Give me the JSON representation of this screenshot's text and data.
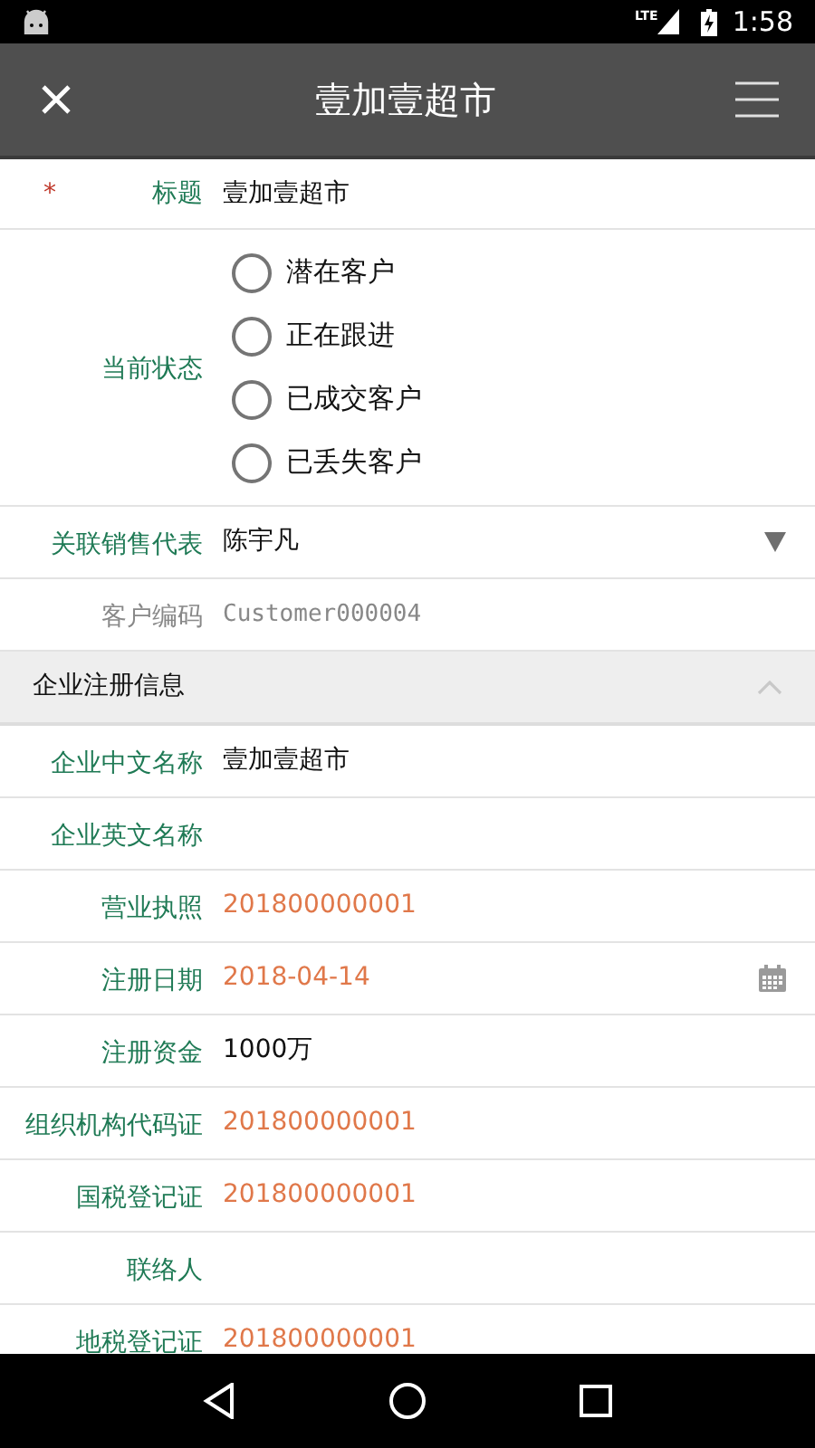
{
  "status_bar": {
    "network": "LTE",
    "time": "1:58"
  },
  "app_bar": {
    "title": "壹加壹超市"
  },
  "title_field": {
    "required_mark": "*",
    "label": "标题",
    "value": "壹加壹超市"
  },
  "status_field": {
    "label": "当前状态",
    "options": [
      {
        "label": "潜在客户",
        "selected": false
      },
      {
        "label": "正在跟进",
        "selected": false
      },
      {
        "label": "已成交客户",
        "selected": false
      },
      {
        "label": "已丢失客户",
        "selected": false
      }
    ]
  },
  "fields": [
    {
      "kind": "select",
      "label": "关联销售代表",
      "value": "陈宇凡",
      "disabled": false
    },
    {
      "kind": "text",
      "label": "客户编码",
      "value": "Customer000004",
      "disabled": true
    }
  ],
  "section": {
    "title": "企业注册信息",
    "expanded": true
  },
  "section_fields": [
    {
      "kind": "text",
      "label": "企业中文名称",
      "value": "壹加壹超市",
      "highlighted": false
    },
    {
      "kind": "text",
      "label": "企业英文名称"
    },
    {
      "kind": "text",
      "label": "营业执照",
      "value": "201800000001",
      "highlighted": true
    },
    {
      "kind": "date",
      "label": "注册日期",
      "value": "2018-04-14",
      "highlighted": true
    },
    {
      "kind": "text",
      "label": "注册资金",
      "value": "1000万",
      "highlighted": false
    },
    {
      "kind": "text",
      "label": "组织机构代码证",
      "value": "201800000001",
      "highlighted": true
    },
    {
      "kind": "text",
      "label": "国税登记证",
      "value": "201800000001",
      "highlighted": true
    },
    {
      "kind": "text",
      "label": "联络人"
    },
    {
      "kind": "text",
      "label": "地税登记证",
      "value": "201800000001",
      "highlighted": true
    }
  ]
}
